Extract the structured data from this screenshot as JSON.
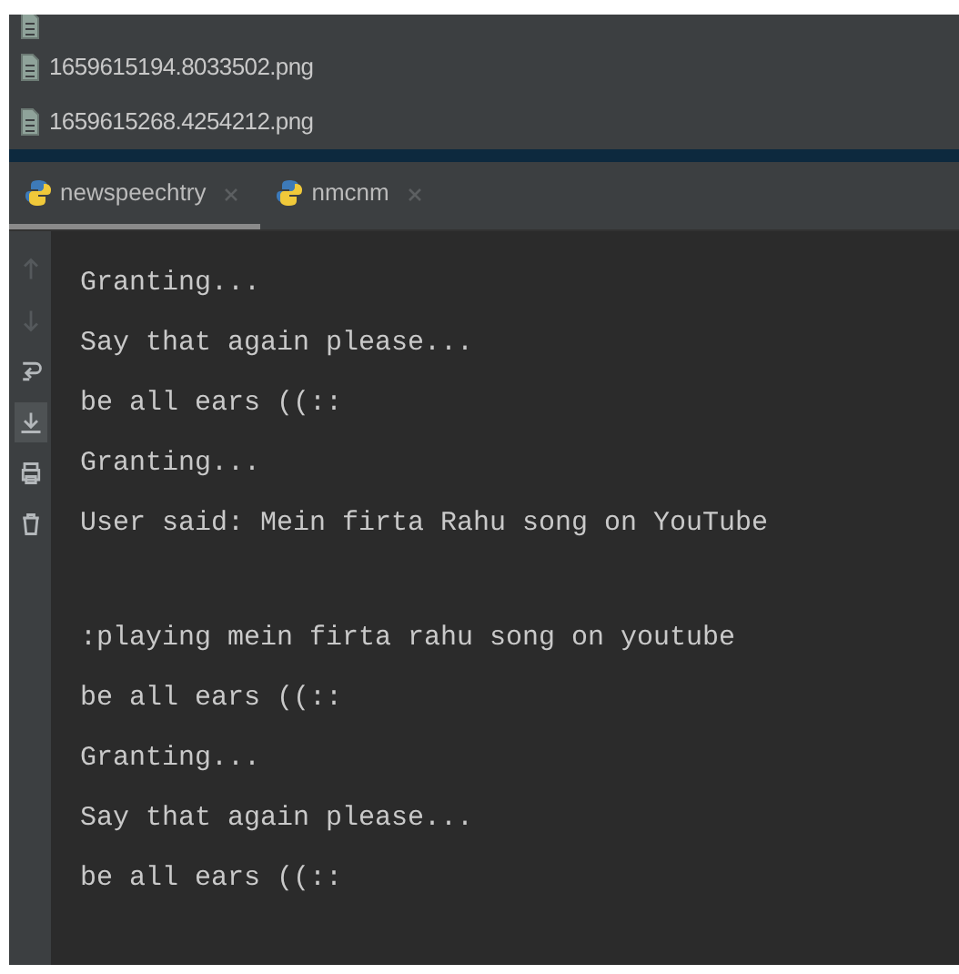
{
  "files": [
    {
      "cut_off": true
    },
    {
      "name": "1659615194.8033502.png"
    },
    {
      "name": "1659615268.4254212.png"
    }
  ],
  "tabs": [
    {
      "label": "newspeechtry",
      "selected": true
    },
    {
      "label": "nmcnm",
      "selected": false
    }
  ],
  "toolbar": [
    {
      "kind": "up",
      "disabled": true
    },
    {
      "kind": "down",
      "disabled": true
    },
    {
      "kind": "wrap",
      "disabled": false
    },
    {
      "kind": "scroll-end",
      "disabled": false,
      "selected": true
    },
    {
      "kind": "print",
      "disabled": false
    },
    {
      "kind": "trash",
      "disabled": false
    }
  ],
  "console": [
    {
      "text": "Granting...",
      "gap_before": false
    },
    {
      "text": "Say that again please...",
      "gap_before": false
    },
    {
      "text": "be all ears ((::",
      "gap_before": false
    },
    {
      "text": "Granting...",
      "gap_before": false
    },
    {
      "text": "User said: Mein firta Rahu song on YouTube",
      "gap_before": false
    },
    {
      "text": ":playing mein firta rahu song on youtube",
      "gap_before": true
    },
    {
      "text": "be all ears ((::",
      "gap_before": false
    },
    {
      "text": "Granting...",
      "gap_before": false
    },
    {
      "text": "Say that again please...",
      "gap_before": false
    },
    {
      "text": "be all ears ((::",
      "gap_before": false
    }
  ]
}
